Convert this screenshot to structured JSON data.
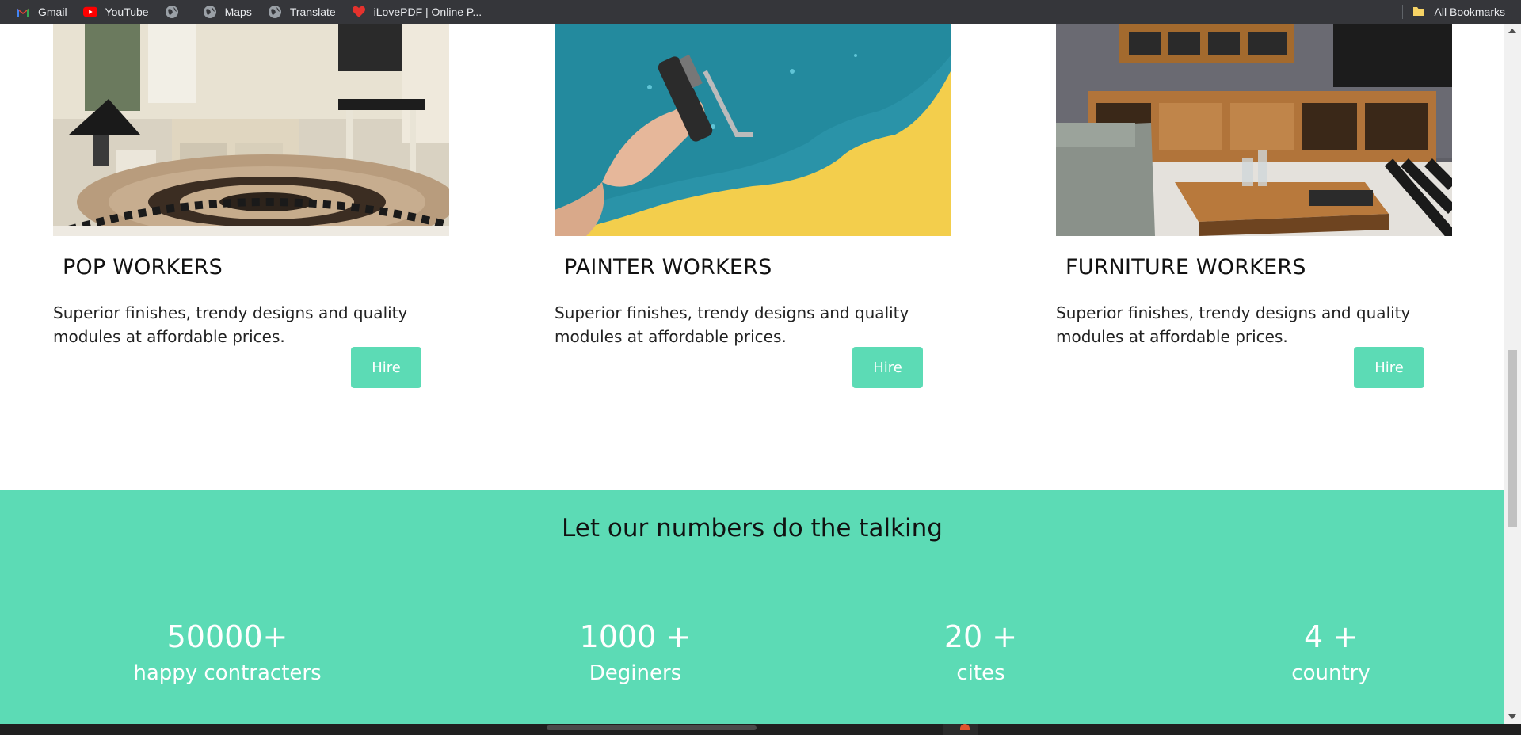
{
  "bookmarks": {
    "items": [
      {
        "label": "Gmail",
        "icon": "gmail-icon"
      },
      {
        "label": "YouTube",
        "icon": "youtube-icon"
      },
      {
        "label": "",
        "icon": "globe-icon"
      },
      {
        "label": "Maps",
        "icon": "globe-icon"
      },
      {
        "label": "Translate",
        "icon": "globe-icon"
      },
      {
        "label": "iLovePDF | Online P...",
        "icon": "ilovepdf-icon"
      }
    ],
    "all_bookmarks": "All Bookmarks"
  },
  "cards": [
    {
      "title": "POP WORKERS",
      "desc": "Superior finishes, trendy designs and quality modules at affordable prices.",
      "button": "Hire"
    },
    {
      "title": "PAINTER WORKERS",
      "desc": "Superior finishes, trendy designs and quality modules at affordable prices.",
      "button": "Hire"
    },
    {
      "title": "FURNITURE WORKERS",
      "desc": "Superior finishes, trendy designs and quality modules at affordable prices.",
      "button": "Hire"
    }
  ],
  "stats": {
    "title": "Let our numbers do the talking",
    "items": [
      {
        "number": "50000+",
        "label": "happy contracters"
      },
      {
        "number": "1000 +",
        "label": "Deginers"
      },
      {
        "number": "20 +",
        "label": "cites"
      },
      {
        "number": "4 +",
        "label": "country"
      }
    ]
  },
  "colors": {
    "accent": "#5cdbb5",
    "bookmarks_bar": "#35363a"
  }
}
